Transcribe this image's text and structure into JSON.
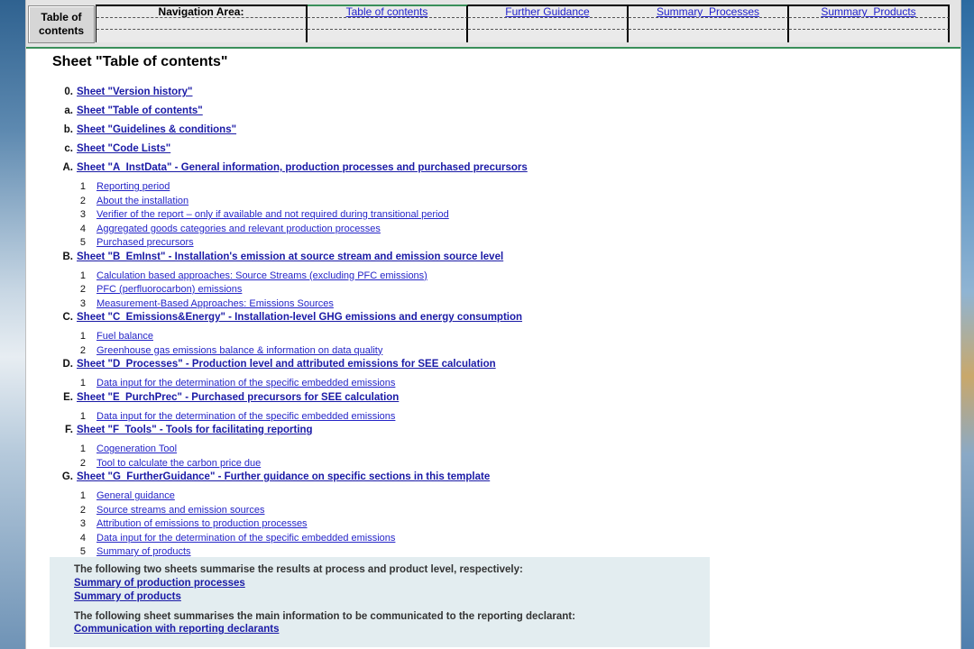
{
  "nav": {
    "home_label": "Table of\ncontents",
    "area_label": "Navigation Area:",
    "links": [
      "Table of contents",
      "Further Guidance",
      "Summary_Processes",
      "Summary_Products"
    ]
  },
  "sheet_title": "Sheet \"Table of contents\"",
  "sections": [
    {
      "key": "0.",
      "label": "Sheet \"Version history\"",
      "items": []
    },
    {
      "key": "a.",
      "label": "Sheet \"Table of contents\"",
      "items": []
    },
    {
      "key": "b.",
      "label": "Sheet \"Guidelines & conditions\"",
      "items": []
    },
    {
      "key": "c.",
      "label": "Sheet \"Code Lists\"",
      "items": []
    },
    {
      "key": "A.",
      "label": "Sheet \"A_InstData\" - General information, production processes and purchased precursors",
      "items": [
        {
          "num": "1",
          "label": "Reporting period"
        },
        {
          "num": "2",
          "label": "About the installation"
        },
        {
          "num": "3",
          "label": "Verifier of the report – only if available and not required during transitional period"
        },
        {
          "num": "4",
          "label": "Aggregated goods categories and relevant production processes"
        },
        {
          "num": "5",
          "label": "Purchased precursors"
        }
      ]
    },
    {
      "key": "B.",
      "label": "Sheet \"B_EmInst\" - Installation's emission at source stream and emission source level",
      "items": [
        {
          "num": "1",
          "label": "Calculation based approaches: Source Streams (excluding PFC emissions)"
        },
        {
          "num": "2",
          "label": "PFC (perfluorocarbon) emissions"
        },
        {
          "num": "3",
          "label": "Measurement-Based Approaches: Emissions Sources"
        }
      ]
    },
    {
      "key": "C.",
      "label": "Sheet \"C_Emissions&Energy\" - Installation-level GHG emissions and energy consumption",
      "items": [
        {
          "num": "1",
          "label": "Fuel balance"
        },
        {
          "num": "2",
          "label": "Greenhouse gas emissions balance & information on data quality"
        }
      ]
    },
    {
      "key": "D.",
      "label": "Sheet \"D_Processes\" - Production level and attributed emissions for SEE calculation",
      "items": [
        {
          "num": "1",
          "label": "Data input for the determination of the specific embedded emissions"
        }
      ]
    },
    {
      "key": "E.",
      "label": "Sheet \"E_PurchPrec\" - Purchased precursors for SEE calculation",
      "items": [
        {
          "num": "1",
          "label": "Data input for the determination of the specific embedded emissions"
        }
      ]
    },
    {
      "key": "F.",
      "label": "Sheet \"F_Tools\" - Tools for facilitating reporting",
      "items": [
        {
          "num": "1",
          "label": "Cogeneration Tool"
        },
        {
          "num": "2",
          "label": "Tool to calculate the carbon price due"
        }
      ]
    },
    {
      "key": "G.",
      "label": "Sheet \"G_FurtherGuidance\" - Further guidance on specific sections in this template",
      "items": [
        {
          "num": "1",
          "label": "General guidance"
        },
        {
          "num": "2",
          "label": "Source streams and emission sources"
        },
        {
          "num": "3",
          "label": "Attribution of emissions to production processes"
        },
        {
          "num": "4",
          "label": "Data input for the determination of the specific embedded emissions"
        },
        {
          "num": "5",
          "label": "Summary of products"
        }
      ]
    }
  ],
  "summary": {
    "note1": "The following two sheets summarise the results at process and product level, respectively:",
    "link1": "Summary of production processes",
    "link2": "Summary of products",
    "note2": "The following sheet summarises the main information to be communicated to the reporting declarant:",
    "link3": "Communication with reporting declarants"
  },
  "colors": {
    "link": "#1a1aa6",
    "summary_bg": "#e3edf0",
    "nav_accent": "#3a8f5a"
  }
}
